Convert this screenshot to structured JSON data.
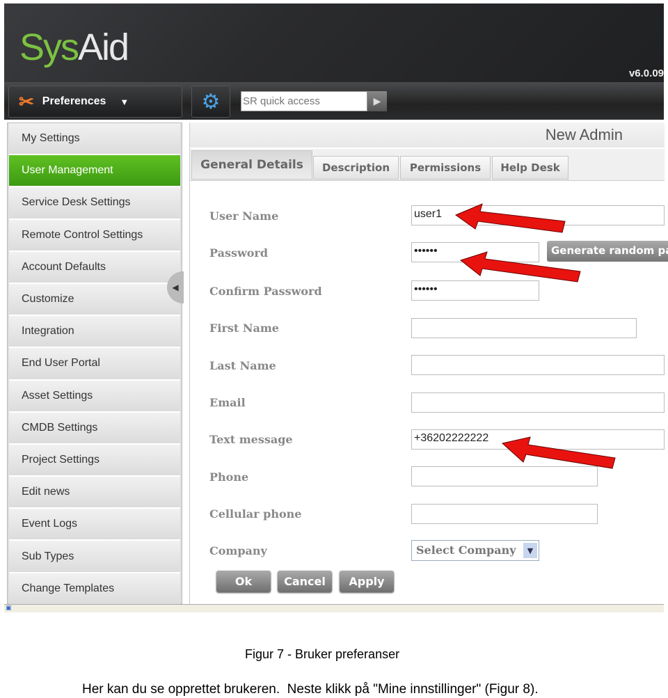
{
  "header": {
    "logo": "SysAid",
    "version": "v6.0.09"
  },
  "toolbar": {
    "preferences_label": "Preferences",
    "search_placeholder": "SR quick access"
  },
  "sidebar": {
    "items": [
      {
        "label": "My Settings"
      },
      {
        "label": "User Management",
        "active": true
      },
      {
        "label": "Service Desk Settings"
      },
      {
        "label": "Remote Control Settings"
      },
      {
        "label": "Account Defaults"
      },
      {
        "label": "Customize"
      },
      {
        "label": "Integration"
      },
      {
        "label": "End User Portal"
      },
      {
        "label": "Asset Settings"
      },
      {
        "label": "CMDB Settings"
      },
      {
        "label": "Project Settings"
      },
      {
        "label": "Edit news"
      },
      {
        "label": "Event Logs"
      },
      {
        "label": "Sub Types"
      },
      {
        "label": "Change Templates"
      }
    ]
  },
  "main": {
    "title": "New Admin",
    "tabs": [
      {
        "label": "General Details",
        "active": true
      },
      {
        "label": "Description"
      },
      {
        "label": "Permissions"
      },
      {
        "label": "Help Desk"
      }
    ],
    "form": {
      "user_name": {
        "label": "User Name",
        "value": "user1"
      },
      "password": {
        "label": "Password",
        "value": "••••••"
      },
      "generate_label": "Generate random pa",
      "confirm_password": {
        "label": "Confirm Password",
        "value": "••••••"
      },
      "first_name": {
        "label": "First Name",
        "value": ""
      },
      "last_name": {
        "label": "Last Name",
        "value": ""
      },
      "email": {
        "label": "Email",
        "value": ""
      },
      "text_message": {
        "label": "Text message",
        "value": "+36202222222"
      },
      "phone": {
        "label": "Phone",
        "value": ""
      },
      "cellular_phone": {
        "label": "Cellular phone",
        "value": ""
      },
      "company": {
        "label": "Company",
        "value": "Select Company"
      }
    },
    "buttons": {
      "ok": "Ok",
      "cancel": "Cancel",
      "apply": "Apply"
    }
  },
  "annotation_color": "#e8130f",
  "caption": {
    "figure": "Figur 7 - Bruker preferanser",
    "text": "Her kan du se opprettet brukeren.  Neste klikk på \"Mine innstillinger\" (Figur 8)."
  }
}
